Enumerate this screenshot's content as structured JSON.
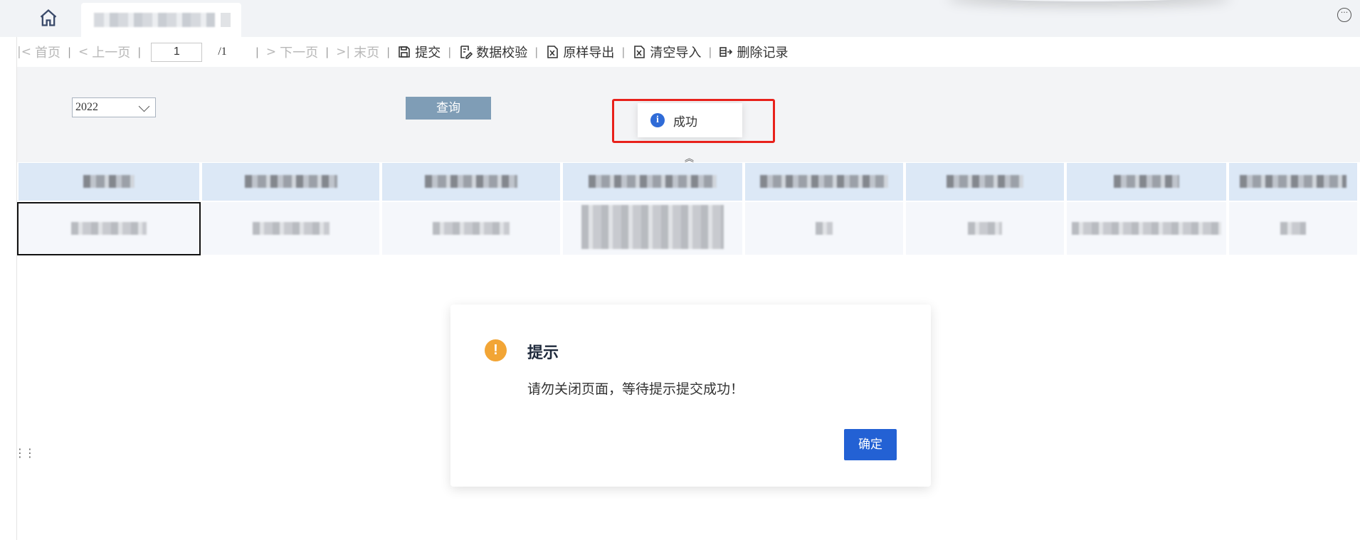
{
  "tabbar": {
    "home_icon": "home-icon",
    "tab_label": "",
    "more_icon": "more-icon"
  },
  "toolbar": {
    "first": "首页",
    "prev": "上一页",
    "page_value": "1",
    "total": "/1",
    "next": "下一页",
    "last": "末页",
    "submit": "提交",
    "validate": "数据校验",
    "export": "原样导出",
    "clear_import": "清空导入",
    "delete_record": "删除记录"
  },
  "filter": {
    "year": "2022",
    "query_label": "查询"
  },
  "toast": {
    "text": "成功",
    "icon": "i"
  },
  "table": {
    "columns": 8
  },
  "modal": {
    "icon": "!",
    "title": "提示",
    "message": "请勿关闭页面，等待提示提交成功！",
    "ok_label": "确定"
  },
  "colors": {
    "accent": "#2361d4",
    "warning": "#f2a535",
    "highlight": "#e8211b",
    "header_bg": "#dce8f6"
  }
}
